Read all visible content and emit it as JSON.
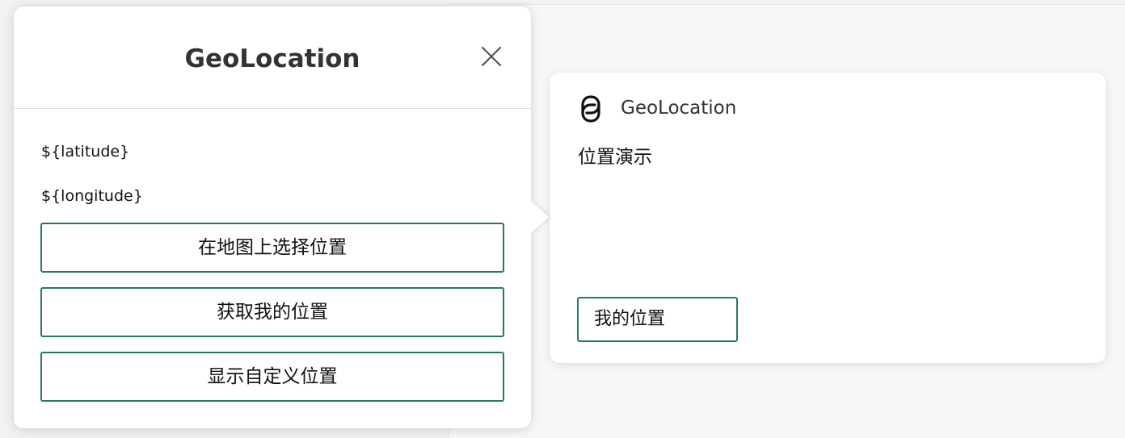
{
  "popup": {
    "title": "GeoLocation",
    "latitude_text": "${latitude}",
    "longitude_text": "${longitude}",
    "buttons": [
      {
        "label": "在地图上选择位置"
      },
      {
        "label": "获取我的位置"
      },
      {
        "label": "显示自定义位置"
      }
    ],
    "close_icon": "close-icon"
  },
  "card": {
    "app_name": "GeoLocation",
    "logo_icon": "app-logo-icon",
    "title": "位置演示",
    "button_label": "我的位置"
  },
  "colors": {
    "accent": "#227a5f",
    "title_text": "#333333",
    "background": "#f2f2f2"
  }
}
